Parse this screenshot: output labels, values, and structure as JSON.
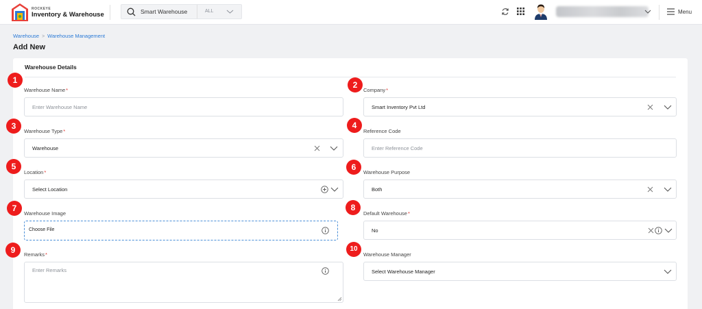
{
  "header": {
    "brand_small": "ROCKEYE",
    "brand_name": "Inventory & Warehouse",
    "search": {
      "value": "Smart Warehouse",
      "scope": "ALL"
    },
    "menu_label": "Menu"
  },
  "breadcrumb": {
    "items": [
      "Warehouse",
      "Warehouse Management"
    ],
    "separator": ">"
  },
  "page_title": "Add New",
  "section_title": "Warehouse Details",
  "required_mark": "*",
  "fields": {
    "warehouse_name": {
      "label": "Warehouse Name",
      "placeholder": "Enter Warehouse Name"
    },
    "company": {
      "label": "Company",
      "value": "Smart Inventory Pvt Ltd"
    },
    "warehouse_type": {
      "label": "Warehouse Type",
      "value": "Warehouse"
    },
    "reference_code": {
      "label": "Reference Code",
      "placeholder": "Enter Reference Code"
    },
    "location": {
      "label": "Location",
      "placeholder": "Select Location"
    },
    "warehouse_purpose": {
      "label": "Warehouse Purpose",
      "value": "Both"
    },
    "warehouse_image": {
      "label": "Warehouse Image",
      "button": "Choose File"
    },
    "default_warehouse": {
      "label": "Default Warehouse",
      "value": "No"
    },
    "remarks": {
      "label": "Remarks",
      "placeholder": "Enter Remarks"
    },
    "warehouse_manager": {
      "label": "Warehouse Manager",
      "placeholder": "Select Warehouse Manager"
    }
  },
  "badges": [
    "1",
    "2",
    "3",
    "4",
    "5",
    "6",
    "7",
    "8",
    "9",
    "10"
  ],
  "icons": {
    "search": "search-icon",
    "refresh": "refresh-icon",
    "apps": "grid-icon",
    "menu": "hamburger-icon",
    "clear": "close-icon",
    "dropdown": "chevron-down-icon",
    "info": "info-icon",
    "add": "plus-circle-icon"
  },
  "colors": {
    "accent": "#2b7ad6",
    "badge": "#ee1c1c",
    "required": "#e0342f",
    "background": "#f0f1f3"
  }
}
